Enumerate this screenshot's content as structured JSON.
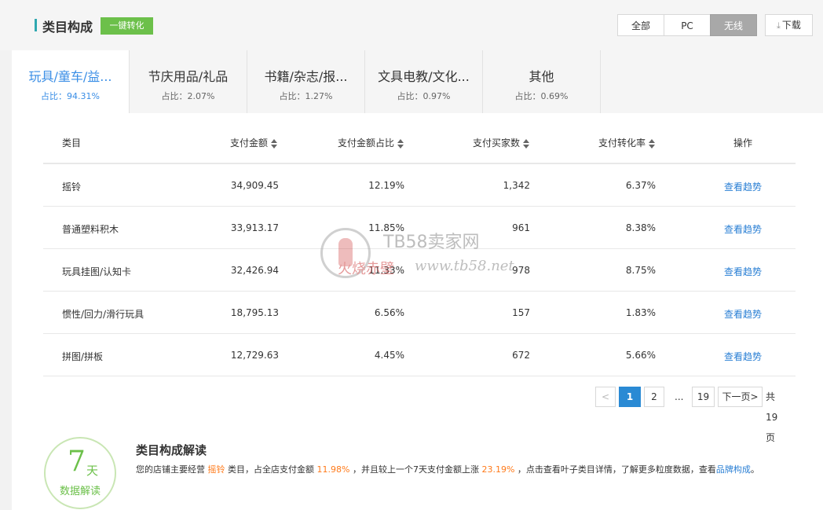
{
  "header": {
    "title": "类目构成",
    "convert_button": "一键转化",
    "segments": [
      "全部",
      "PC",
      "无线"
    ],
    "active_segment": "无线",
    "download_label": "下载"
  },
  "tabs": [
    {
      "name": "玩具/童车/益...",
      "share": "占比：94.31%",
      "active": true
    },
    {
      "name": "节庆用品/礼品",
      "share": "占比：2.07%",
      "active": false
    },
    {
      "name": "书籍/杂志/报...",
      "share": "占比：1.27%",
      "active": false
    },
    {
      "name": "文具电教/文化...",
      "share": "占比：0.97%",
      "active": false
    },
    {
      "name": "其他",
      "share": "占比：0.69%",
      "active": false
    }
  ],
  "table": {
    "headers": [
      "类目",
      "支付金额",
      "支付金额占比",
      "支付买家数",
      "支付转化率",
      "操作"
    ],
    "rows": [
      {
        "category": "摇铃",
        "amount": "34,909.45",
        "amount_share": "12.19%",
        "buyers": "1,342",
        "conversion": "6.37%",
        "action": "查看趋势"
      },
      {
        "category": "普通塑料积木",
        "amount": "33,913.17",
        "amount_share": "11.85%",
        "buyers": "961",
        "conversion": "8.38%",
        "action": "查看趋势"
      },
      {
        "category": "玩具挂图/认知卡",
        "amount": "32,426.94",
        "amount_share": "11.33%",
        "buyers": "978",
        "conversion": "8.75%",
        "action": "查看趋势"
      },
      {
        "category": "惯性/回力/滑行玩具",
        "amount": "18,795.13",
        "amount_share": "6.56%",
        "buyers": "157",
        "conversion": "1.83%",
        "action": "查看趋势"
      },
      {
        "category": "拼图/拼板",
        "amount": "12,729.63",
        "amount_share": "4.45%",
        "buyers": "672",
        "conversion": "5.66%",
        "action": "查看趋势"
      }
    ]
  },
  "pagination": {
    "prev": "<",
    "pages": [
      "1",
      "2"
    ],
    "ellipsis": "...",
    "last_page": "19",
    "next": "下一页",
    "next_arrow": ">",
    "total": "共19页",
    "current": 1
  },
  "insight": {
    "circle_number": "7",
    "circle_unit": "天",
    "circle_label": "数据解读",
    "title": "类目构成解读",
    "text_1": "您的店铺主要经营",
    "category": "摇铃",
    "text_2": "类目，占全店支付金额",
    "share": "11.98%",
    "text_3": "，并且较上一个7天支付金额上涨",
    "growth": "23.19%",
    "text_4": "，点击查看叶子类目详情，了解更多粒度数据，查看",
    "link": "品牌构成",
    "text_5": "。"
  },
  "watermark": {
    "name": "TB58卖家网",
    "url": "www.tb58.net",
    "sub": "火烧赤壁"
  },
  "colors": {
    "accent": "#3a8ee6",
    "green": "#6cc04a",
    "orange": "#ff7a1a",
    "link": "#2a7fd4"
  }
}
